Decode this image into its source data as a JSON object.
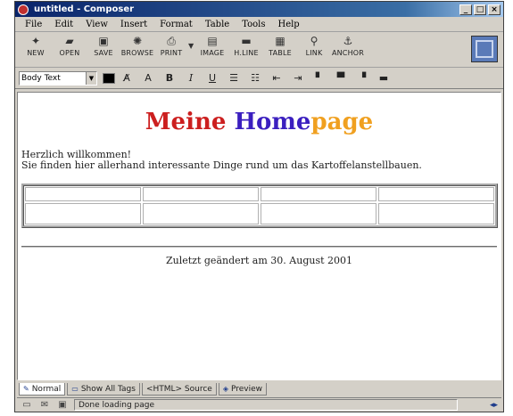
{
  "window": {
    "title": "untitled - Composer"
  },
  "menu": [
    "File",
    "Edit",
    "View",
    "Insert",
    "Format",
    "Table",
    "Tools",
    "Help"
  ],
  "toolbar": [
    {
      "label": "New",
      "icon": "new-icon",
      "glyph": "✦"
    },
    {
      "label": "Open",
      "icon": "open-icon",
      "glyph": "▰"
    },
    {
      "label": "Save",
      "icon": "save-icon",
      "glyph": "▣"
    },
    {
      "label": "Browse",
      "icon": "browse-icon",
      "glyph": "✺"
    },
    {
      "label": "Print",
      "icon": "print-icon",
      "glyph": "⎙"
    },
    {
      "label": "Image",
      "icon": "image-icon",
      "glyph": "▤"
    },
    {
      "label": "H.Line",
      "icon": "hline-icon",
      "glyph": "▬"
    },
    {
      "label": "Table",
      "icon": "table-icon",
      "glyph": "▦"
    },
    {
      "label": "Link",
      "icon": "link-icon",
      "glyph": "⚲"
    },
    {
      "label": "Anchor",
      "icon": "anchor-icon",
      "glyph": "⚓"
    }
  ],
  "format": {
    "paragraph_style": "Body Text"
  },
  "document": {
    "heading": {
      "part1": "Meine ",
      "part2": "Home",
      "part3": "page"
    },
    "line1": "Herzlich willkommen!",
    "line2": "Sie finden hier allerhand interessante Dinge rund um das Kartoffelanstellbauen.",
    "footer": "Zuletzt geändert am 30. August 2001"
  },
  "tabs": [
    "Normal",
    "Show All Tags",
    "<HTML> Source",
    "Preview"
  ],
  "status": {
    "text": "Done loading page"
  }
}
